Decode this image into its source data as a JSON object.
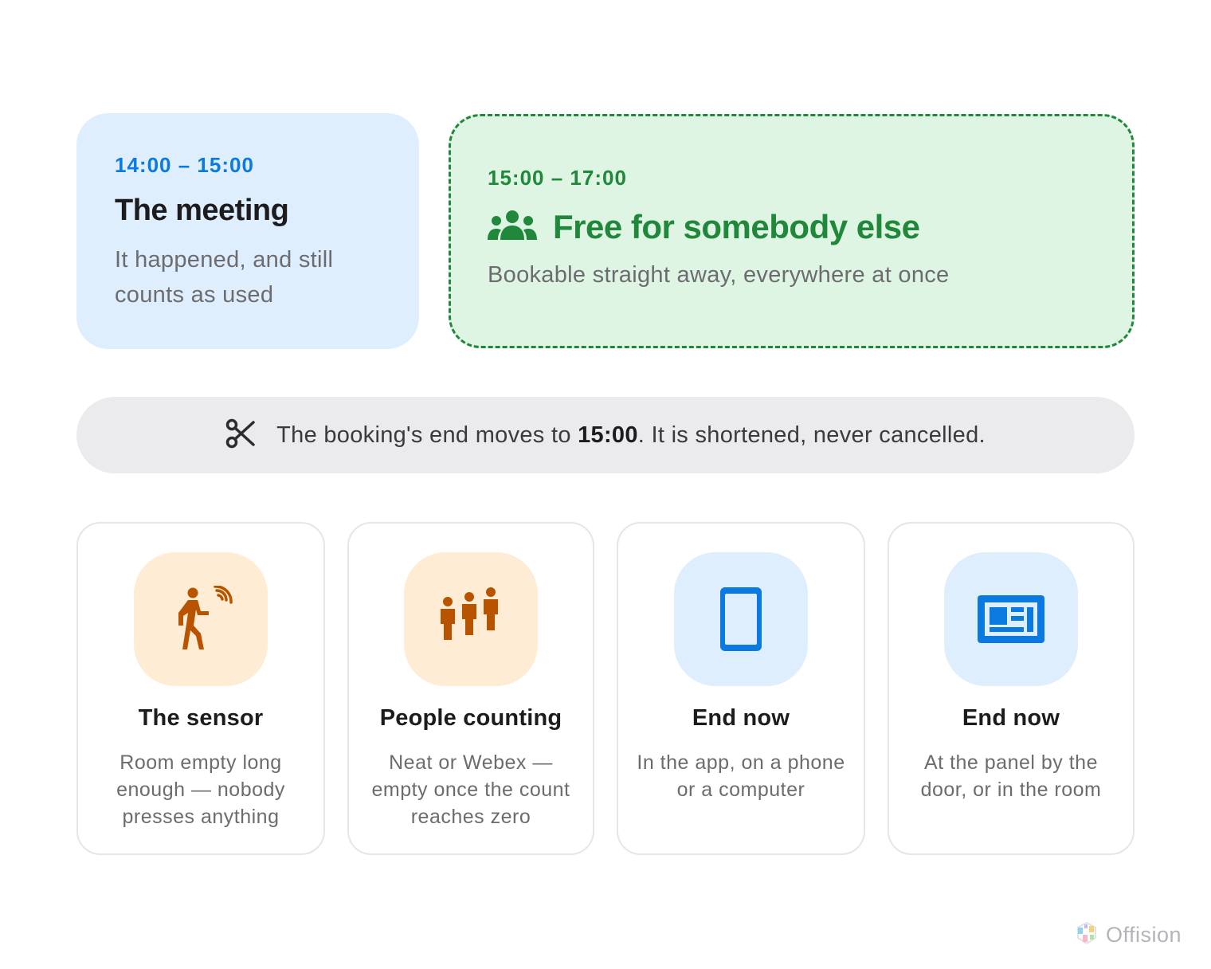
{
  "used_block": {
    "time": "14:00 – 15:00",
    "title": "The meeting",
    "desc_line1": "It happened, and still",
    "desc_line2": "counts as used"
  },
  "free_block": {
    "time": "15:00 – 17:00",
    "icon": "people-group-icon",
    "title": "Free for somebody else",
    "desc": "Bookable straight away, everywhere at once"
  },
  "banner": {
    "icon": "scissors-icon",
    "text_before": "The booking's end moves to ",
    "time": "15:00",
    "text_after": ". It is shortened, never cancelled."
  },
  "triggers": [
    {
      "icon": "person-walking-sensor-icon",
      "title": "The sensor",
      "desc_lines": [
        "Room empty long",
        "enough — nobody",
        "presses anything"
      ]
    },
    {
      "icon": "people-counting-icon",
      "title": "People counting",
      "desc_lines": [
        "Neat or Webex —",
        "empty once the count",
        "reaches zero"
      ]
    },
    {
      "icon": "phone-icon",
      "title": "End now",
      "desc_lines": [
        "In the app, on a phone",
        "or a computer"
      ]
    },
    {
      "icon": "door-panel-icon",
      "title": "End now",
      "desc_lines": [
        "At the panel by the",
        "door, or in the room"
      ]
    }
  ],
  "brand": {
    "name": "Offision",
    "icon": "offision-logo-icon"
  },
  "colors": {
    "blue_accent": "#0b7ae0",
    "green_accent": "#21873a",
    "orange_accent": "#b85400",
    "used_bg": "#dfeefd",
    "free_bg": "#dff5e3",
    "banner_bg": "#ebebed"
  }
}
